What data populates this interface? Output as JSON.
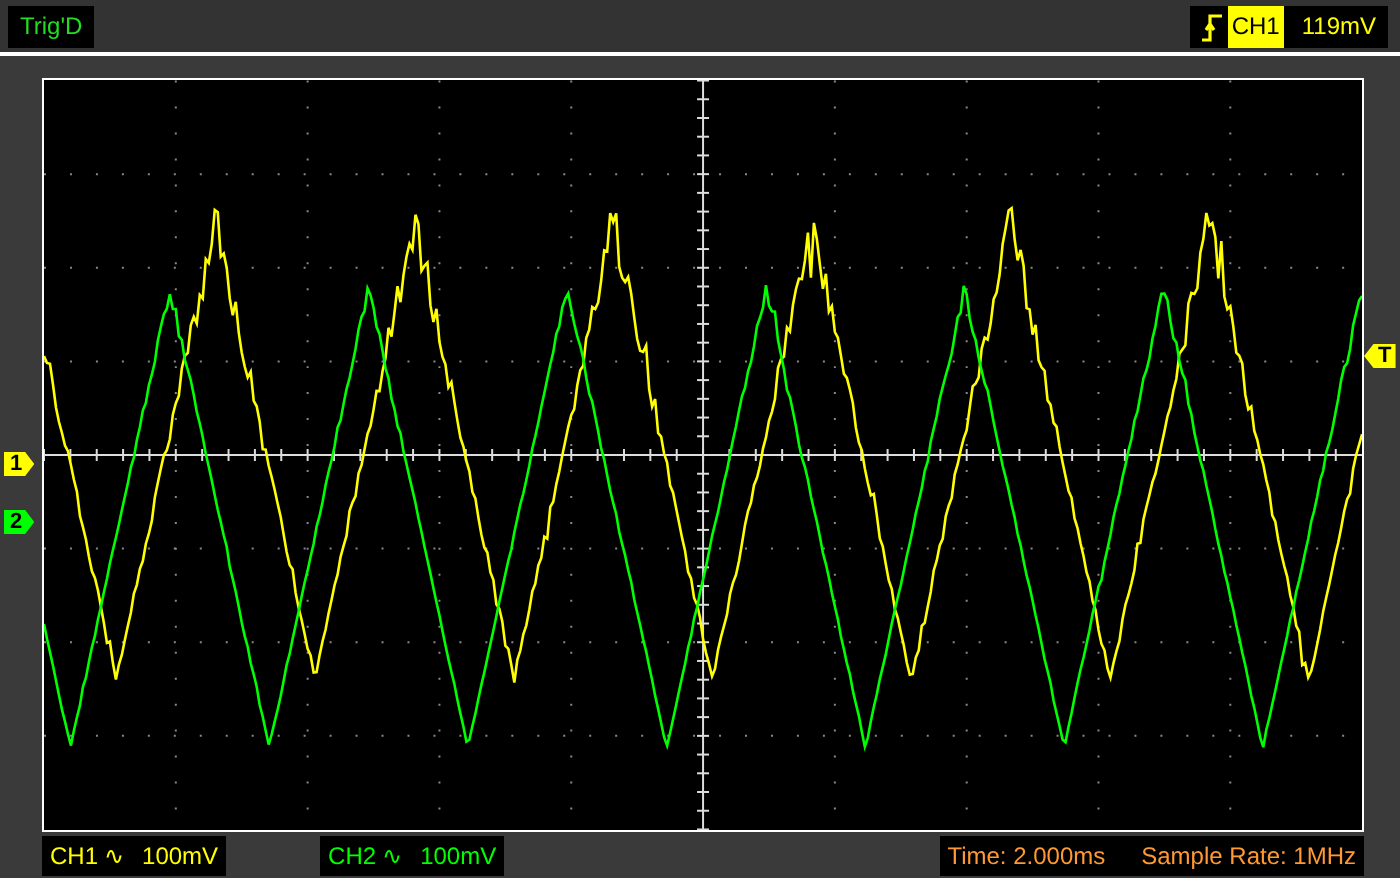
{
  "top_bar": {
    "trigger_status": "Trig'D",
    "trigger_channel": "CH1",
    "trigger_level": "119mV"
  },
  "left_markers": [
    {
      "label": "1",
      "color": "#ffff00"
    },
    {
      "label": "2",
      "color": "#00ff00"
    }
  ],
  "right_marker": {
    "label": "T"
  },
  "channels": [
    {
      "name": "CH1",
      "coupling": "∿",
      "scale": "100mV",
      "color": "#ffff00"
    },
    {
      "name": "CH2",
      "coupling": "∿",
      "scale": "100mV",
      "color": "#00ff00"
    }
  ],
  "time": "Time: 2.000ms",
  "sample_rate": "Sample Rate: 1MHz"
}
